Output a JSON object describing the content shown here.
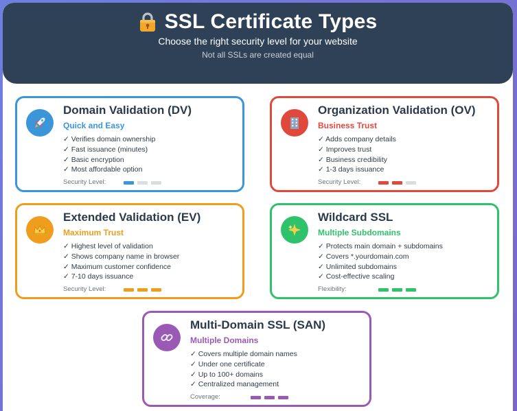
{
  "header": {
    "title": "SSL Certificate Types",
    "subtitle": "Choose the right security level for your website",
    "tagline": "Not all SSLs are created equal",
    "icon": "lock-icon"
  },
  "cards": [
    {
      "id": "dv",
      "name": "Domain Validation (DV)",
      "tagline": "Quick and Easy",
      "color": "#3a96d8",
      "icon": "rocket-icon",
      "features": [
        "✓ Verifies domain ownership",
        "✓ Fast issuance (minutes)",
        "✓ Basic encryption",
        "✓ Most affordable option"
      ],
      "meter_label": "Security Level:",
      "meter_level": 1,
      "meter_max": 3
    },
    {
      "id": "ov",
      "name": "Organization Validation (OV)",
      "tagline": "Business Trust",
      "color": "#e0483c",
      "icon": "office-building-icon",
      "features": [
        "✓ Adds company details",
        "✓ Improves trust",
        "✓ Business credibility",
        "✓ 1-3 days issuance"
      ],
      "meter_label": "Security Level:",
      "meter_level": 2,
      "meter_max": 3
    },
    {
      "id": "ev",
      "name": "Extended Validation (EV)",
      "tagline": "Maximum Trust",
      "color": "#ef9d1c",
      "icon": "crown-icon",
      "features": [
        "✓ Highest level of validation",
        "✓ Shows company name in browser",
        "✓ Maximum customer confidence",
        "✓ 7-10 days issuance"
      ],
      "meter_label": "Security Level:",
      "meter_level": 3,
      "meter_max": 3
    },
    {
      "id": "wildcard",
      "name": "Wildcard SSL",
      "tagline": "Multiple Subdomains",
      "color": "#2ec26b",
      "icon": "sparkle-icon",
      "features": [
        "✓ Protects main domain + subdomains",
        "✓ Covers *.yourdomain.com",
        "✓ Unlimited subdomains",
        "✓ Cost-effective scaling"
      ],
      "meter_label": "Flexibility:",
      "meter_level": 3,
      "meter_max": 3
    },
    {
      "id": "san",
      "name": "Multi-Domain SSL (SAN)",
      "tagline": "Multiple Domains",
      "color": "#9b59b6",
      "icon": "link-icon",
      "features": [
        "✓ Covers multiple domain names",
        "✓ Under one certificate",
        "✓ Up to 100+ domains",
        "✓ Centralized management"
      ],
      "meter_label": "Coverage:",
      "meter_level": 3,
      "meter_max": 3
    }
  ]
}
